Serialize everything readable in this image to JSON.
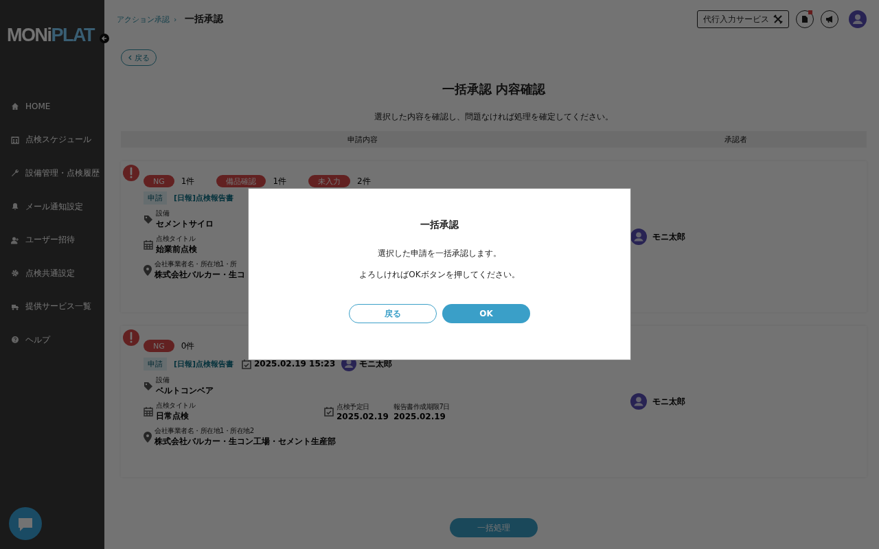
{
  "sidebar": {
    "logo": {
      "part_1": "MONi",
      "part_2": "PLAT"
    },
    "items": [
      {
        "label": "HOME"
      },
      {
        "label": "点検スケジュール"
      },
      {
        "label": "設備管理・点検履歴"
      },
      {
        "label": "メール通知設定"
      },
      {
        "label": "ユーザー招待"
      },
      {
        "label": "点検共通設定"
      },
      {
        "label": "提供サービス一覧"
      },
      {
        "label": "ヘルプ"
      }
    ]
  },
  "header": {
    "breadcrumb": {
      "parent": "アクション承認",
      "separator": "›",
      "current": "一括承認"
    },
    "service_button": "代行入力サービス"
  },
  "back_button": "戻る",
  "page_title": "一括承認 内容確認",
  "page_subtitle": "選択した内容を確認し、問題なければ処理を確定してください。",
  "table": {
    "columns": [
      "申請内容",
      "承認者"
    ],
    "rows": [
      {
        "tags": [
          {
            "label": "NG",
            "count": "1件"
          },
          {
            "label": "備品確認",
            "count": "1件"
          },
          {
            "label": "未入力",
            "count": "2件"
          }
        ],
        "type_tag": "申請",
        "report": "[日報]点検報告書",
        "equipment": {
          "label": "設備",
          "value": "セメントサイロ"
        },
        "title": {
          "label": "点検タイトル",
          "value": "始業前点検"
        },
        "address": {
          "label": "会社事業者名・所在地1・所",
          "value": "株式会社バルカー・生コ"
        },
        "approver": "モニ太郎"
      },
      {
        "tags": [
          {
            "label": "NG",
            "count": "0件"
          }
        ],
        "type_tag": "申請",
        "report": "[日報]点検報告書",
        "submitted": {
          "value": "2025.02.19 15:23"
        },
        "applicant": {
          "value": "モニ太郎"
        },
        "equipment": {
          "label": "設備",
          "value": "ベルトコンベア"
        },
        "title": {
          "label": "点検タイトル",
          "value": "日常点検"
        },
        "scheduled": {
          "label": "点検予定日",
          "value": "2025.02.19"
        },
        "deadline": {
          "label": "報告書作成期限7日",
          "value": "2025.02.19"
        },
        "address": {
          "label": "会社事業者名・所在地1・所在地2",
          "value": "株式会社バルカー・生コン工場・セメント生産部"
        },
        "approver": "モニ太郎"
      }
    ]
  },
  "submit_button": "一括処理",
  "dialog": {
    "title": "一括承認",
    "lines": [
      "選択した申請を一括承認します。",
      "よろしければOKボタンを押してください。"
    ],
    "cancel_button": "戻る",
    "ok_button": "OK"
  }
}
